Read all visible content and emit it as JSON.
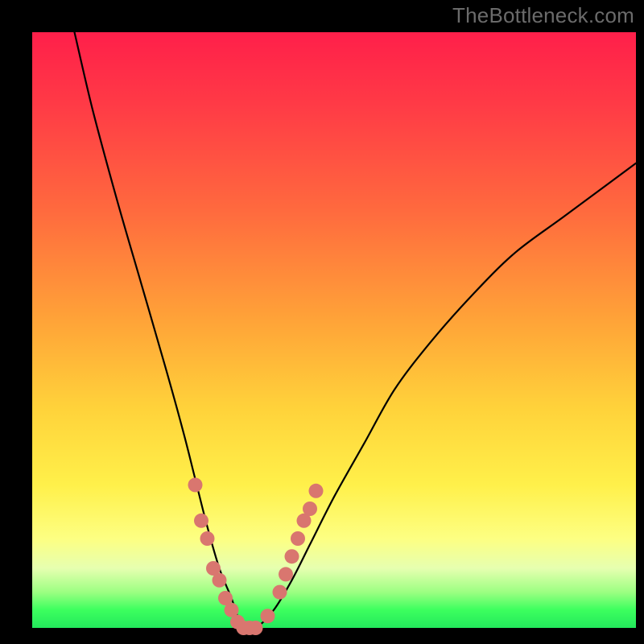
{
  "watermark": "TheBottleneck.com",
  "chart_data": {
    "type": "line",
    "title": "",
    "xlabel": "",
    "ylabel": "",
    "xlim": [
      0,
      100
    ],
    "ylim": [
      0,
      100
    ],
    "grid": false,
    "legend": false,
    "series": [
      {
        "name": "bottleneck-curve",
        "x": [
          7,
          10,
          14,
          18,
          22,
          25,
          27,
          29,
          31,
          33,
          34,
          35,
          37,
          40,
          43,
          46,
          50,
          55,
          60,
          66,
          73,
          80,
          88,
          96,
          100
        ],
        "y": [
          100,
          87,
          72,
          58,
          44,
          33,
          25,
          17,
          10,
          5,
          2,
          0,
          0,
          3,
          8,
          14,
          22,
          31,
          40,
          48,
          56,
          63,
          69,
          75,
          78
        ]
      }
    ],
    "highlight_points": {
      "name": "marker-dots",
      "color": "#d9766f",
      "points": [
        {
          "x": 27,
          "y": 24
        },
        {
          "x": 28,
          "y": 18
        },
        {
          "x": 29,
          "y": 15
        },
        {
          "x": 30,
          "y": 10
        },
        {
          "x": 31,
          "y": 8
        },
        {
          "x": 32,
          "y": 5
        },
        {
          "x": 33,
          "y": 3
        },
        {
          "x": 34,
          "y": 1
        },
        {
          "x": 35,
          "y": 0
        },
        {
          "x": 36,
          "y": 0
        },
        {
          "x": 37,
          "y": 0
        },
        {
          "x": 39,
          "y": 2
        },
        {
          "x": 41,
          "y": 6
        },
        {
          "x": 42,
          "y": 9
        },
        {
          "x": 43,
          "y": 12
        },
        {
          "x": 44,
          "y": 15
        },
        {
          "x": 45,
          "y": 18
        },
        {
          "x": 46,
          "y": 20
        },
        {
          "x": 47,
          "y": 23
        }
      ]
    },
    "background_gradient_stops": [
      {
        "pct": 0,
        "color": "#ff1f4a"
      },
      {
        "pct": 30,
        "color": "#ff6a3e"
      },
      {
        "pct": 63,
        "color": "#ffd23a"
      },
      {
        "pct": 85,
        "color": "#fdff82"
      },
      {
        "pct": 100,
        "color": "#23e85c"
      }
    ]
  }
}
